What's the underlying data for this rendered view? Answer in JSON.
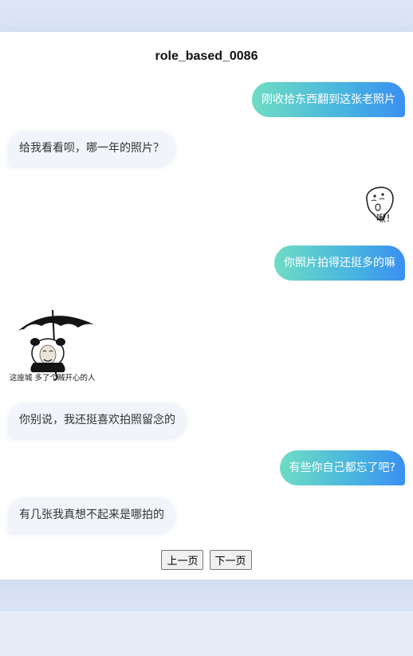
{
  "title": "role_based_0086",
  "messages": [
    {
      "side": "right",
      "text": "刚收拾东西翻到这张老照片"
    },
    {
      "side": "left",
      "text": "给我看看呗，哪一年的照片？"
    },
    {
      "side": "right",
      "sticker": "surprised-ghost-sticker",
      "caption": "啾！"
    },
    {
      "side": "right",
      "text": "你照片拍得还挺多的嘛"
    },
    {
      "side": "left",
      "sticker": "panda-umbrella-sticker",
      "caption": "这座城 多了个贼开心的人"
    },
    {
      "side": "left",
      "text": "你别说，我还挺喜欢拍照留念的"
    },
    {
      "side": "right",
      "text": "有些你自己都忘了吧?"
    },
    {
      "side": "left",
      "text": "有几张我真想不起来是哪拍的"
    }
  ],
  "pager": {
    "prev": "上一页",
    "next": "下一页"
  }
}
